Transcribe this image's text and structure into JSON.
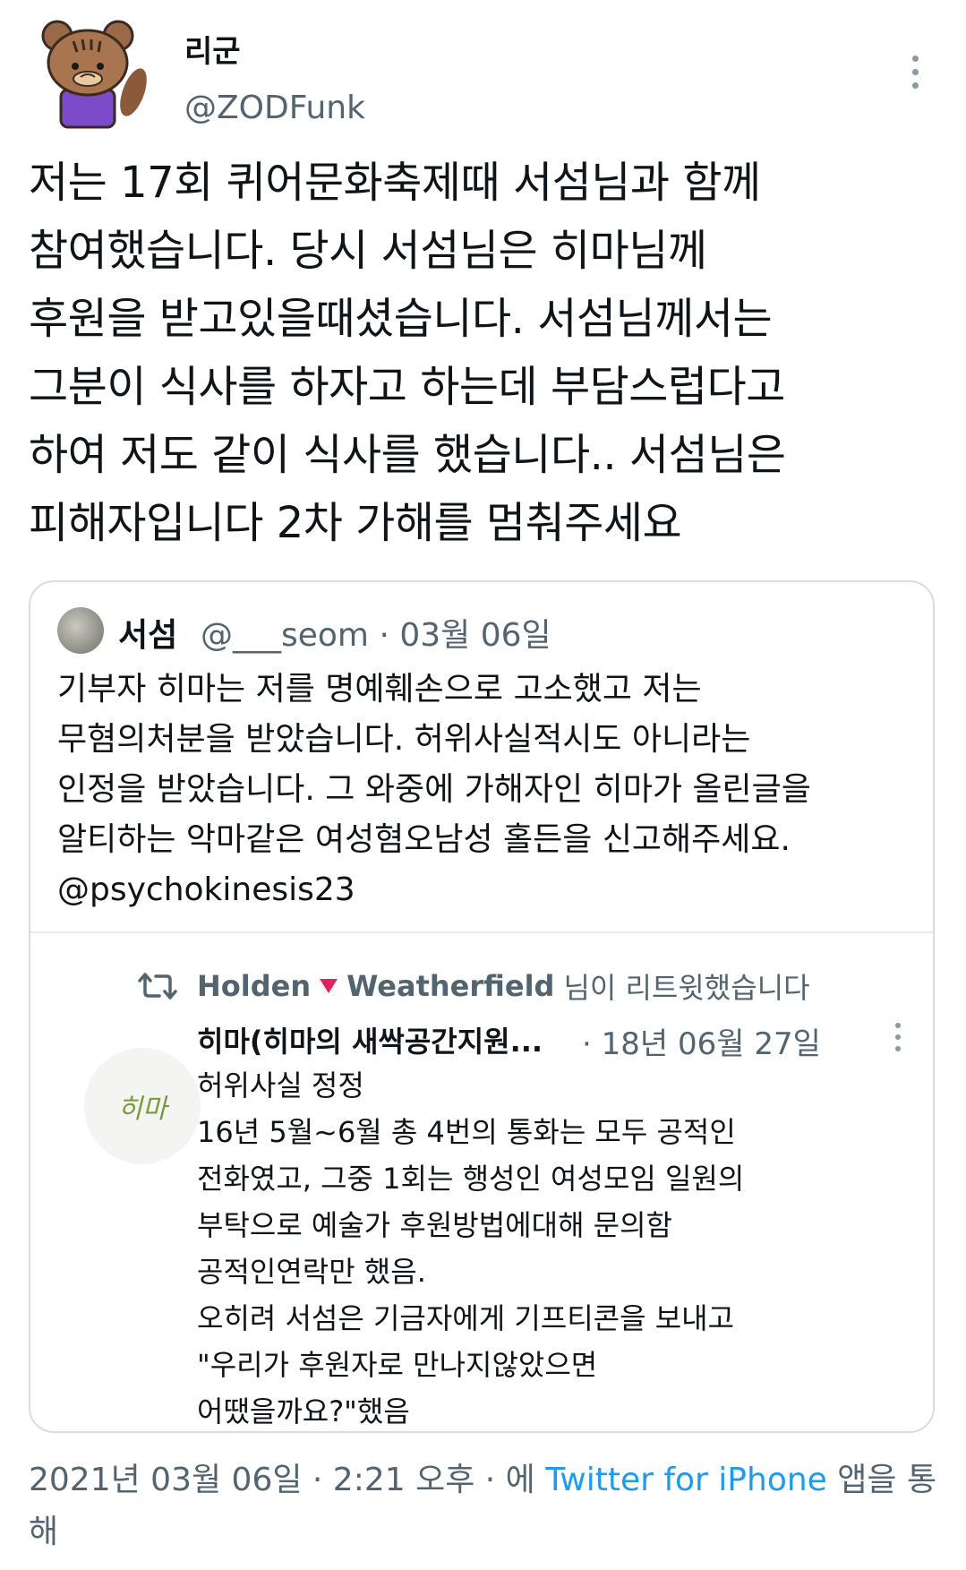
{
  "author": {
    "name": "리군",
    "handle": "@ZODFunk"
  },
  "tweet": {
    "lines": [
      "저는 17회 퀴어문화축제때 서섬님과 함께",
      "참여했습니다. 당시 서섬님은 히마님께",
      "후원을 받고있을때셨습니다. 서섬님께서는",
      "그분이 식사를 하자고 하는데 부담스럽다고",
      "하여 저도 같이 식사를 했습니다.. 서섬님은",
      "피해자입니다 2차 가해를 멈춰주세요"
    ]
  },
  "quote": {
    "name": "서섬",
    "meta": "@___seom · 03월 06일",
    "lines": [
      "기부자 히마는 저를 명예훼손으로 고소했고 저는",
      "무혐의처분을 받았습니다. 허위사실적시도 아니라는",
      "인정을 받았습니다. 그 와중에 가해자인 히마가 올린글을",
      "알티하는 악마같은 여성혐오남성 홀든을 신고해주세요.",
      "@psychokinesis23"
    ],
    "embed": {
      "retweet_name_1": "Holden",
      "retweet_name_2": "Weatherfield",
      "retweet_suffix": "님이 리트윗했습니다",
      "avatar_text": "히마",
      "name": "히마(히마의 새싹공간지원...",
      "date": "· 18년 06월 27일",
      "lines": [
        "허위사실 정정",
        "16년 5월~6월 총 4번의 통화는 모두 공적인",
        "전화였고, 그중 1회는 행성인 여성모임 일원의",
        "부탁으로 예술가 후원방법에대해 문의함",
        "공적인연락만 했음.",
        "오히려 서섬은 기금자에게 기프티콘을 보내고",
        "\"우리가 후원자로 만나지않았으면",
        "어땠을까요?\"했음"
      ]
    }
  },
  "footer": {
    "timestamp": "2021년 03월 06일 · 2:21 오후 · 에",
    "source": "Twitter for iPhone",
    "suffix": "앱을 통해"
  },
  "colors": {
    "text": "#0f1419",
    "secondary": "#536471",
    "link": "#1d9bf0",
    "border": "#d9dde0",
    "heart": "#e0245e"
  },
  "icons": [
    "more-icon",
    "retweet-icon",
    "heart-icon"
  ]
}
